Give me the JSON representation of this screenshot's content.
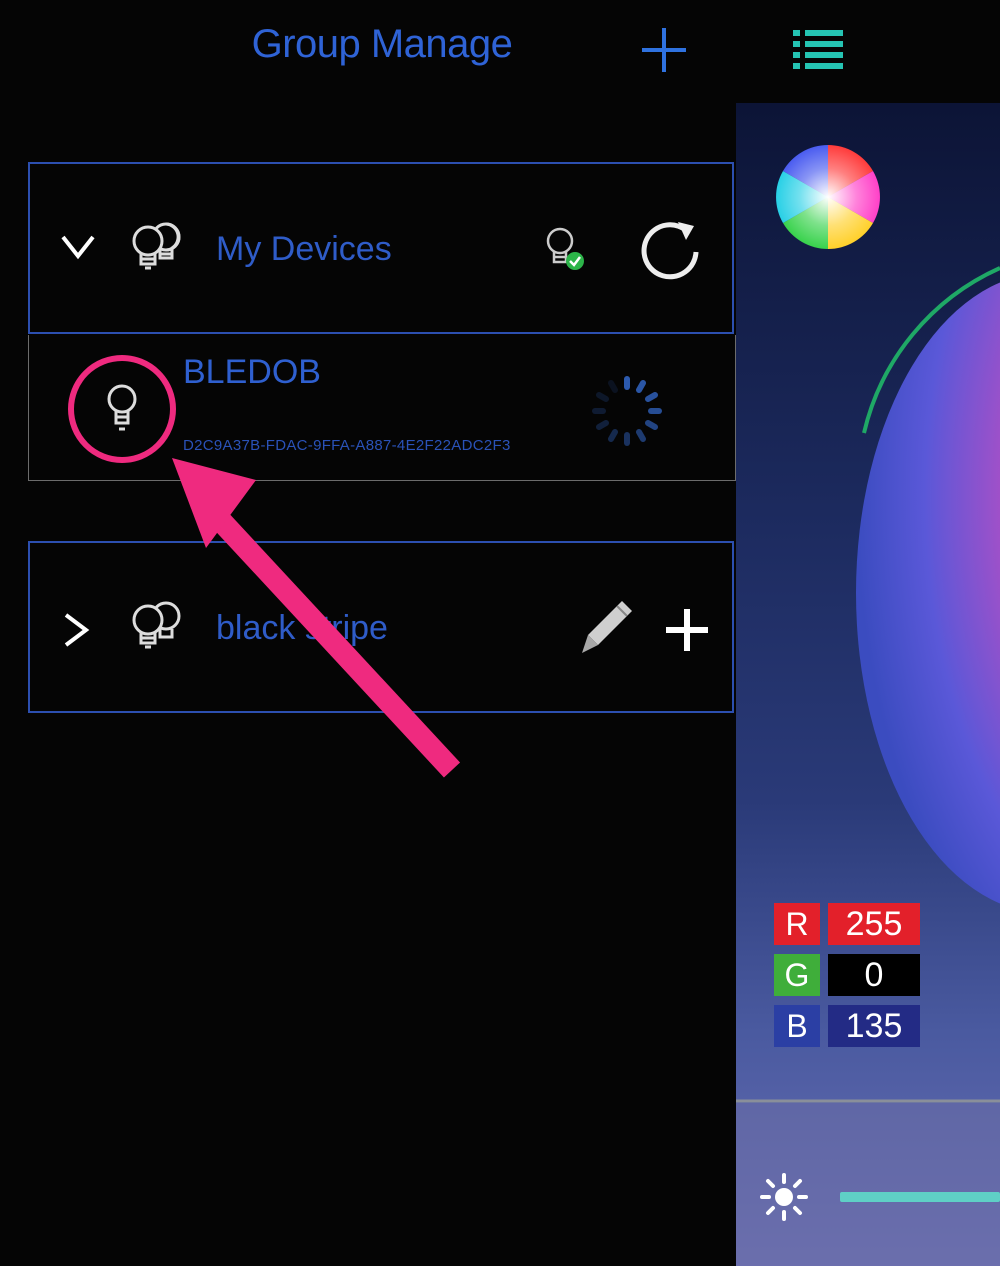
{
  "header": {
    "title": "Group Manage",
    "add_icon": "plus-icon",
    "menu_icon": "list-icon"
  },
  "groups": [
    {
      "name": "My Devices",
      "expanded": true,
      "devices": [
        {
          "name": "BLEDOB",
          "id": "D2C9A37B-FDAC-9FFA-A887-4E2F22ADC2F3",
          "status": "connecting"
        }
      ]
    },
    {
      "name": "black stripe",
      "expanded": false
    }
  ],
  "rgb": {
    "r_label": "R",
    "r_value": "255",
    "g_label": "G",
    "g_value": "0",
    "b_label": "B",
    "b_value": "135"
  },
  "colors": {
    "accent": "#2f63d6",
    "teal": "#29c7b5",
    "annotation": "#ef2a7f",
    "r": "#e3202a",
    "g": "#3fae3a",
    "b": "#2b3fa4"
  }
}
